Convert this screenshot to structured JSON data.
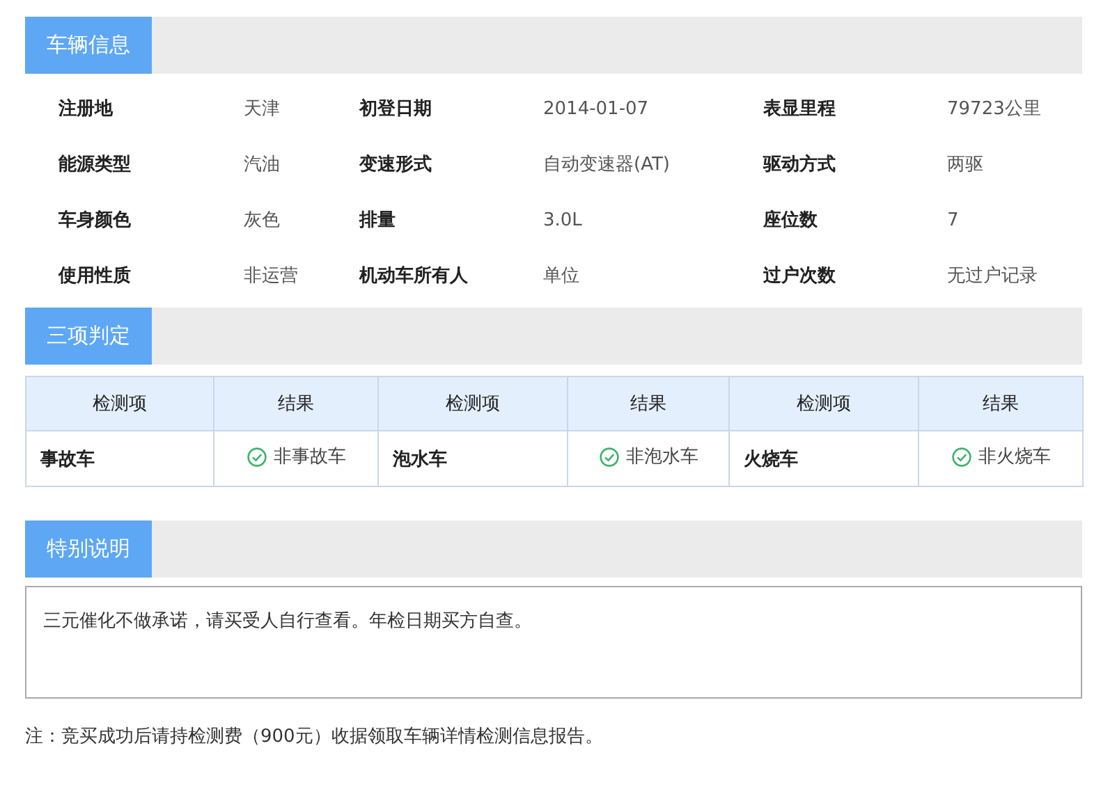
{
  "vehicle_info": {
    "title": "车辆信息",
    "rows": [
      [
        {
          "label": "注册地",
          "value": "天津"
        },
        {
          "label": "初登日期",
          "value": "2014-01-07"
        },
        {
          "label": "表显里程",
          "value": "79723公里"
        }
      ],
      [
        {
          "label": "能源类型",
          "value": "汽油"
        },
        {
          "label": "变速形式",
          "value": "自动变速器(AT)"
        },
        {
          "label": "驱动方式",
          "value": "两驱"
        }
      ],
      [
        {
          "label": "车身颜色",
          "value": "灰色"
        },
        {
          "label": "排量",
          "value": "3.0L"
        },
        {
          "label": "座位数",
          "value": "7"
        }
      ],
      [
        {
          "label": "使用性质",
          "value": "非运营"
        },
        {
          "label": "机动车所有人",
          "value": "单位"
        },
        {
          "label": "过户次数",
          "value": "无过户记录"
        }
      ]
    ]
  },
  "judgement": {
    "title": "三项判定",
    "columns": [
      "检测项",
      "结果",
      "检测项",
      "结果",
      "检测项",
      "结果"
    ],
    "checks": [
      {
        "item": "事故车",
        "result": "非事故车",
        "passed": true
      },
      {
        "item": "泡水车",
        "result": "非泡水车",
        "passed": true
      },
      {
        "item": "火烧车",
        "result": "非火烧车",
        "passed": true
      }
    ]
  },
  "special_notes": {
    "title": "特别说明",
    "text": "三元催化不做承诺，请买受人自行查看。年检日期买方自查。"
  },
  "footnote": "注：竞买成功后请持检测费（900元）收据领取车辆详情检测信息报告。"
}
